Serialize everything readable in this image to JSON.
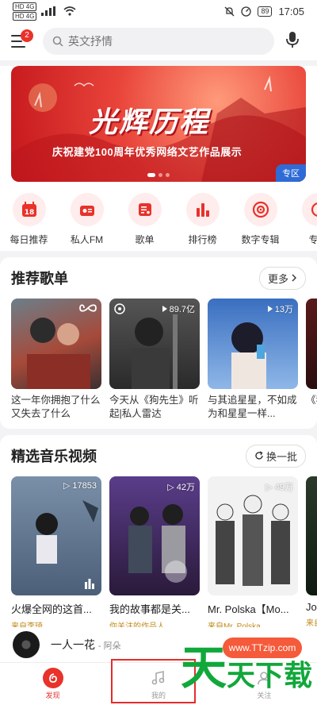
{
  "status_bar": {
    "network_left": "HD 4G",
    "network_left2": "HD 4G",
    "battery": "89",
    "time": "17:05"
  },
  "header": {
    "notification_count": "2",
    "search_placeholder": "英文抒情"
  },
  "banner": {
    "title": "光辉历程",
    "subtitle": "庆祝建党100周年优秀网络文艺作品展示",
    "tag": "专区"
  },
  "quick_entries": [
    {
      "label": "每日推荐",
      "icon": "calendar-icon"
    },
    {
      "label": "私人FM",
      "icon": "radio-icon"
    },
    {
      "label": "歌单",
      "icon": "playlist-icon"
    },
    {
      "label": "排行榜",
      "icon": "chart-icon"
    },
    {
      "label": "数字专辑",
      "icon": "album-icon"
    },
    {
      "label": "专注",
      "icon": "focus-icon"
    }
  ],
  "playlists": {
    "title": "推荐歌单",
    "more": "更多",
    "items": [
      {
        "title": "这一年你拥抱了什么 又失去了什么",
        "count": ""
      },
      {
        "title": "今天从《狗先生》听起|私人雷达",
        "count": "89.7亿"
      },
      {
        "title": "与其追星星，不如成为和星星一样...",
        "count": "13万"
      },
      {
        "title": "《我",
        "count": ""
      }
    ]
  },
  "videos": {
    "title": "精选音乐视频",
    "refresh": "换一批",
    "items": [
      {
        "title": "火爆全网的这首...",
        "source": "来自李琦",
        "count": "17853"
      },
      {
        "title": "我的故事都是关...",
        "source": "你关注的作品人",
        "count": "42万"
      },
      {
        "title": "Mr. Polska【Mo...",
        "source": "来自Mr. Polska",
        "count": "49万"
      },
      {
        "title": "Jor",
        "source": "来自",
        "count": ""
      }
    ]
  },
  "player": {
    "song": "一人一花",
    "artist": " - 阿朵"
  },
  "tabs": [
    {
      "label": "发现"
    },
    {
      "label": "我的"
    },
    {
      "label": "关注"
    }
  ],
  "watermark": {
    "site": "www.TTzip.com",
    "brand": "天天下载"
  },
  "colors": {
    "accent": "#e8322a",
    "banner": "#d92a2a",
    "source_text": "#c28a1a"
  }
}
